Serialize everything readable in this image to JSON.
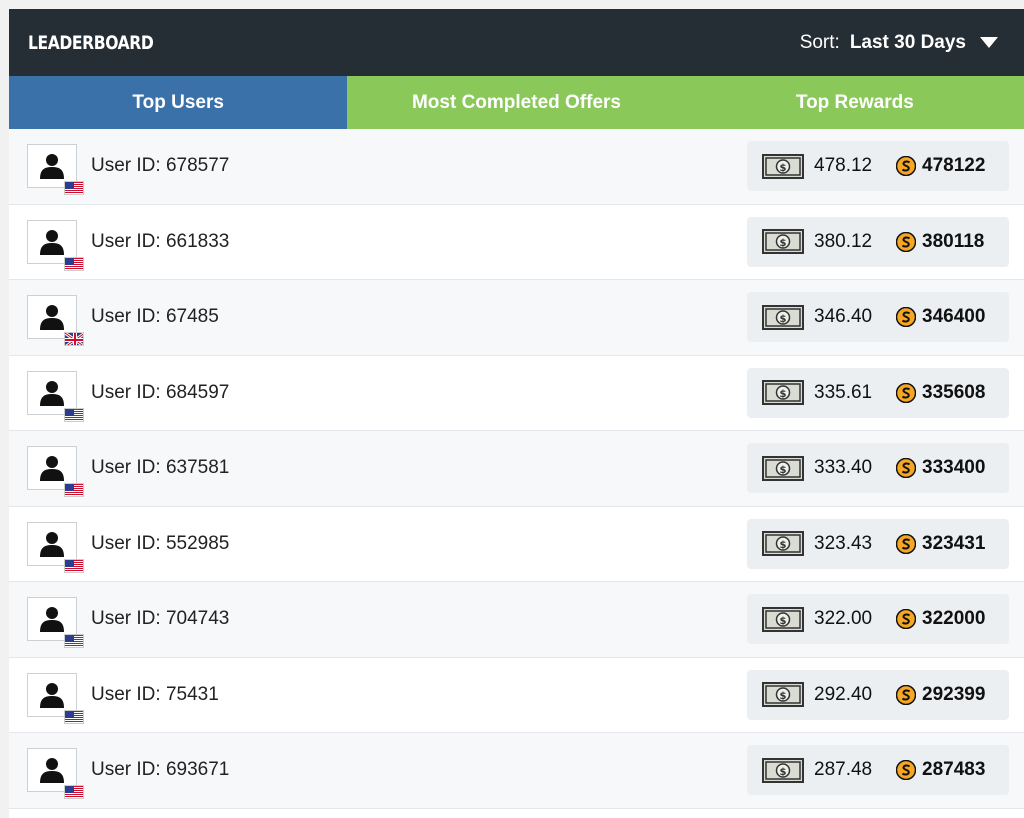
{
  "header": {
    "title": "LEADERBOARD",
    "sort_label": "Sort:",
    "sort_value": "Last 30 Days"
  },
  "tabs": [
    {
      "label": "Top Users",
      "active": true
    },
    {
      "label": "Most Completed Offers",
      "active": false
    },
    {
      "label": "Top Rewards",
      "active": false
    }
  ],
  "colors": {
    "header_bg": "#262e35",
    "tab_active": "#3a71a8",
    "tab_inactive": "#8bc85a",
    "coin": "#f5a623"
  },
  "rows": [
    {
      "user": "User ID: 678577",
      "flag": "us",
      "cash": "478.12",
      "points": "478122"
    },
    {
      "user": "User ID: 661833",
      "flag": "us",
      "cash": "380.12",
      "points": "380118"
    },
    {
      "user": "User ID: 67485",
      "flag": "uk",
      "cash": "346.40",
      "points": "346400"
    },
    {
      "user": "User ID: 684597",
      "flag": "us",
      "cash": "335.61",
      "points": "335608"
    },
    {
      "user": "User ID: 637581",
      "flag": "us",
      "cash": "333.40",
      "points": "333400"
    },
    {
      "user": "User ID: 552985",
      "flag": "us",
      "cash": "323.43",
      "points": "323431"
    },
    {
      "user": "User ID: 704743",
      "flag": "us",
      "cash": "322.00",
      "points": "322000"
    },
    {
      "user": "User ID: 75431",
      "flag": "us",
      "cash": "292.40",
      "points": "292399"
    },
    {
      "user": "User ID: 693671",
      "flag": "us",
      "cash": "287.48",
      "points": "287483"
    }
  ]
}
